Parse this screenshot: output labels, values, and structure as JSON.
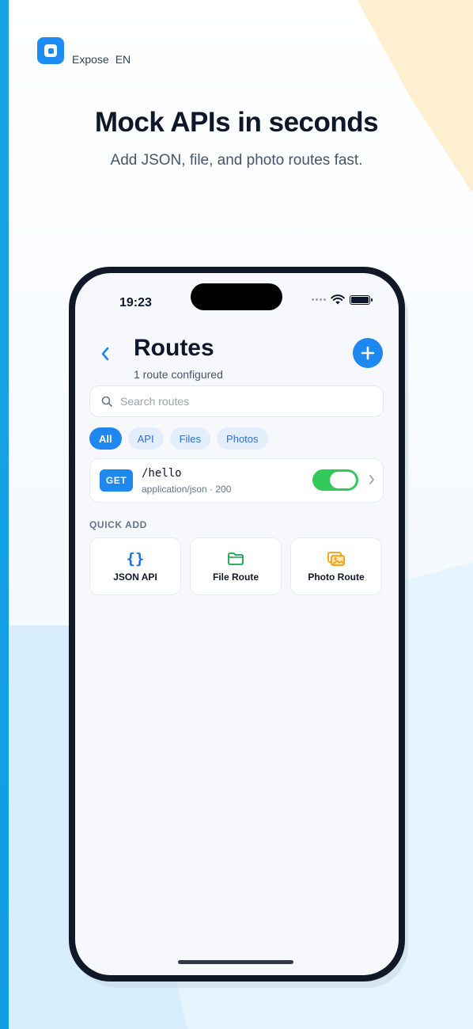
{
  "brand": {
    "name": "Expose",
    "lang": "EN",
    "accent": "#1d8cf3"
  },
  "hero": {
    "title": "Mock APIs in seconds",
    "subtitle": "Add JSON, file, and photo routes fast."
  },
  "status_bar": {
    "time": "19:23"
  },
  "header": {
    "title": "Routes",
    "subtitle": "1 route configured"
  },
  "search": {
    "placeholder": "Search routes"
  },
  "filters": [
    {
      "label": "All",
      "active": true
    },
    {
      "label": "API",
      "active": false
    },
    {
      "label": "Files",
      "active": false
    },
    {
      "label": "Photos",
      "active": false
    }
  ],
  "routes": [
    {
      "method": "GET",
      "path": "/hello",
      "meta": "application/json · 200",
      "enabled": true
    }
  ],
  "quick_add": {
    "label": "QUICK ADD",
    "items": [
      {
        "label": "JSON API",
        "icon": "braces-icon",
        "color": "#1e6fe0"
      },
      {
        "label": "File Route",
        "icon": "folder-icon",
        "color": "#16a34a"
      },
      {
        "label": "Photo Route",
        "icon": "photos-icon",
        "color": "#f59e0b"
      }
    ]
  },
  "colors": {
    "primary": "#1e88f0",
    "toggle_on": "#34c759"
  }
}
